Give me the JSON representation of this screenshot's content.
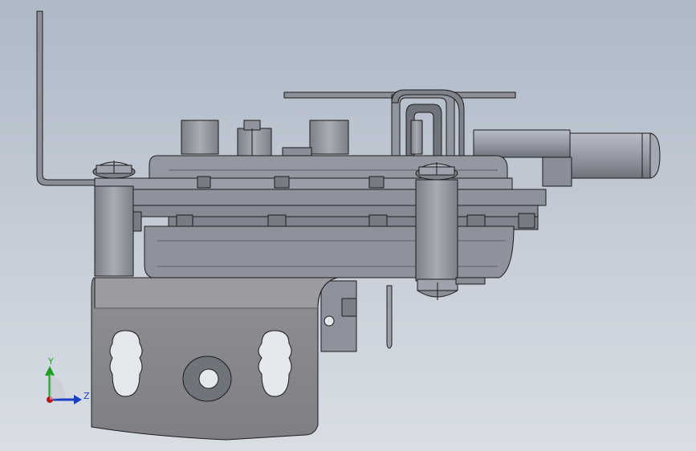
{
  "viewport": {
    "background_top": "#aeb9c6",
    "background_bottom": "#d9dee5"
  },
  "model": {
    "body_color": "#8e929c",
    "edge_color": "#1c1c1c",
    "bracket_color": "#8a8a8e"
  },
  "triad": {
    "y_label": "Y",
    "z_label": "Z",
    "y_color": "#19a019",
    "z_color": "#1b3fc4",
    "origin_color": "#c01414"
  }
}
